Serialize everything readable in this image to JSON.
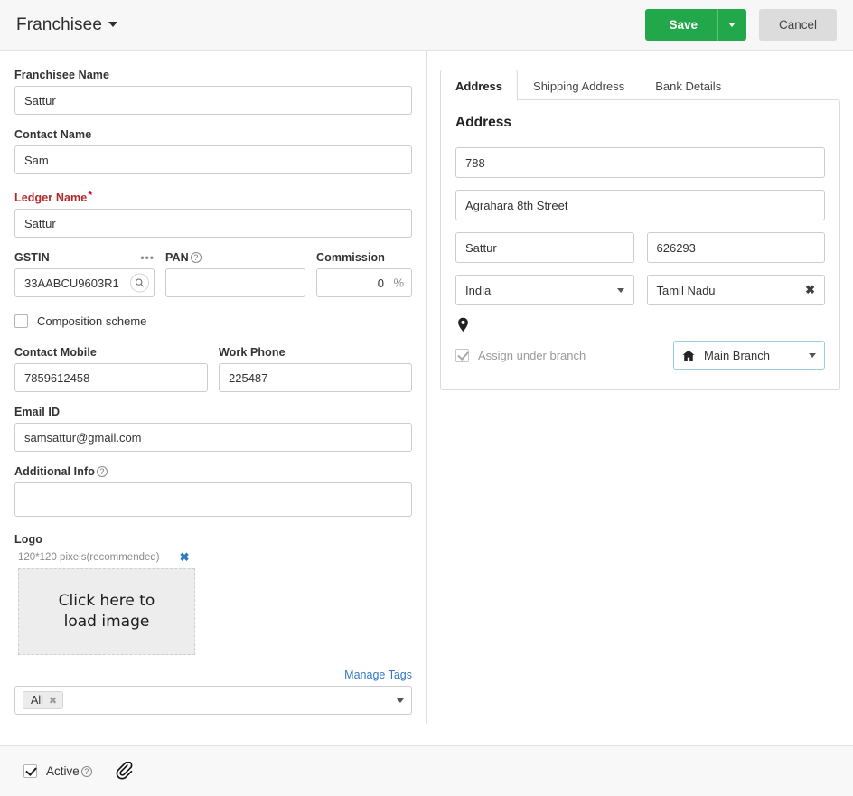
{
  "header": {
    "title": "Franchisee",
    "caret_icon": "chevron-down-icon",
    "save_label": "Save",
    "save_caret_icon": "chevron-down-icon",
    "cancel_label": "Cancel"
  },
  "left_form": {
    "franchisee_name": {
      "label": "Franchisee Name",
      "value": "Sattur",
      "placeholder": ""
    },
    "contact_name": {
      "label": "Contact Name",
      "value": "Sam",
      "placeholder": ""
    },
    "ledger_name": {
      "label": "Ledger Name",
      "required_mark": "*",
      "value": "Sattur",
      "placeholder": ""
    },
    "gstin": {
      "label": "GSTIN",
      "more_icon": "ellipsis-icon",
      "more_glyph": "•••",
      "value": "33AABCU9603R1",
      "placeholder": "",
      "search_icon": "search-icon"
    },
    "pan": {
      "label": "PAN",
      "help_icon": "help-icon",
      "help_glyph": "?",
      "value": "",
      "placeholder": ""
    },
    "commission": {
      "label": "Commission",
      "value": "0",
      "placeholder": "",
      "suffix": "%"
    },
    "composition_scheme": {
      "label": "Composition scheme",
      "checked": false
    },
    "contact_mobile": {
      "label": "Contact Mobile",
      "value": "7859612458",
      "placeholder": ""
    },
    "work_phone": {
      "label": "Work Phone",
      "value": "225487",
      "placeholder": ""
    },
    "email_id": {
      "label": "Email ID",
      "value": "samsattur@gmail.com",
      "placeholder": ""
    },
    "additional_info": {
      "label": "Additional Info",
      "help_icon": "help-icon",
      "help_glyph": "?",
      "value": "",
      "placeholder": ""
    },
    "logo": {
      "label": "Logo",
      "hint": "120*120 pixels(recommended)",
      "remove_icon": "close-x-icon",
      "remove_glyph": "✖",
      "drop_text_line1": "Click here to",
      "drop_text_line2": "load image"
    },
    "tags": {
      "manage_link": "Manage Tags",
      "chips": [
        {
          "label": "All",
          "remove_glyph": "✖"
        }
      ],
      "caret_icon": "chevron-down-icon"
    }
  },
  "right_panel": {
    "tabs": [
      {
        "label": "Address",
        "active": true
      },
      {
        "label": "Shipping Address",
        "active": false
      },
      {
        "label": "Bank Details",
        "active": false
      }
    ],
    "section_title": "Address",
    "address_line1": {
      "value": "788",
      "placeholder": ""
    },
    "address_line2": {
      "value": "Agrahara 8th Street",
      "placeholder": ""
    },
    "city": {
      "value": "Sattur",
      "placeholder": ""
    },
    "pincode": {
      "value": "626293",
      "placeholder": ""
    },
    "country": {
      "value": "India",
      "caret_icon": "chevron-down-icon"
    },
    "state": {
      "value": "Tamil Nadu",
      "clear_icon": "close-x-icon",
      "clear_glyph": "✖"
    },
    "map_pin_icon": "map-pin-icon",
    "assign_branch": {
      "label": "Assign under branch",
      "checked": true,
      "disabled": true
    },
    "branch_select": {
      "value": "Main Branch",
      "home_icon": "home-icon",
      "caret_icon": "chevron-down-icon"
    }
  },
  "footer": {
    "active": {
      "label": "Active",
      "checked": true,
      "help_icon": "help-icon",
      "help_glyph": "?"
    },
    "attachment_icon": "paperclip-icon"
  }
}
